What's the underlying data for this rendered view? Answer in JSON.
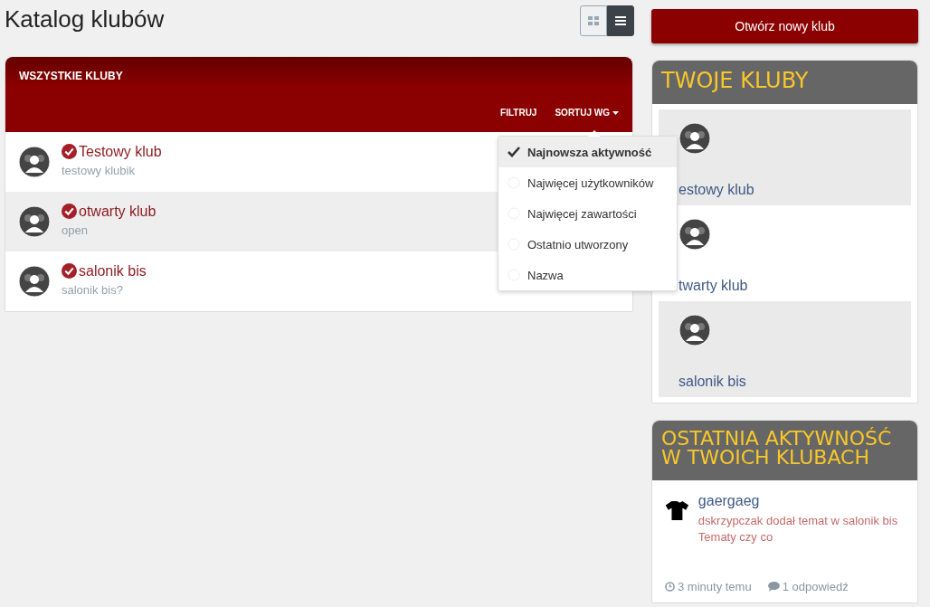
{
  "page_title": "Katalog klubów",
  "view_toggle": [
    {
      "kind": "grid",
      "selected": false
    },
    {
      "kind": "list",
      "selected": true
    }
  ],
  "clubs_panel": {
    "title": "WSZYSTKIE KLUBY",
    "filter_label": "FILTRUJ",
    "sort_label": "SORTUJ WG",
    "clubs": [
      {
        "name": "Testowy klub",
        "description": "testowy klubik"
      },
      {
        "name": "otwarty klub",
        "description": "open"
      },
      {
        "name": "salonik bis",
        "description": "salonik bis?"
      }
    ]
  },
  "sort_menu": [
    {
      "label": "Najnowsza aktywność",
      "selected": true
    },
    {
      "label": "Najwięcej użytkowników",
      "selected": false
    },
    {
      "label": "Najwięcej zawartości",
      "selected": false
    },
    {
      "label": "Ostatnio utworzony",
      "selected": false
    },
    {
      "label": "Nazwa",
      "selected": false
    }
  ],
  "new_club_button": "Otwórz nowy klub",
  "your_clubs": {
    "title": "TWOJE KLUBY",
    "items": [
      "estowy klub",
      "twarty klub",
      "salonik bis"
    ]
  },
  "recent_activity": {
    "title": "OSTATNIA AKTYWNOŚĆ W TWOICH KLUBACH",
    "items": [
      {
        "author": "gaergaeg",
        "text": "dskrzypczak dodał temat w salonik bis Tematy czy co",
        "time": "3 minuty temu",
        "replies": "1 odpowiedź"
      }
    ]
  }
}
